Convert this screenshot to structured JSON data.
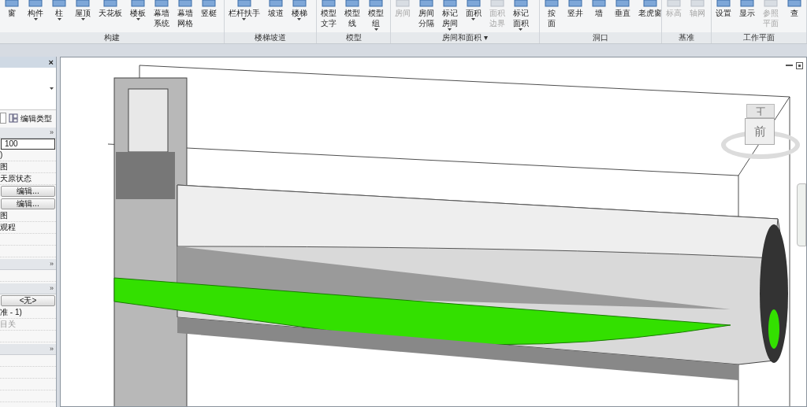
{
  "ribbon": {
    "groups": [
      {
        "label": "构建",
        "buttons": [
          {
            "lines": [
              "窗"
            ],
            "dropdown": false,
            "disabled": false
          },
          {
            "lines": [
              "构件"
            ],
            "dropdown": true,
            "disabled": false
          },
          {
            "lines": [
              "柱"
            ],
            "dropdown": true,
            "disabled": false
          },
          {
            "lines": [
              "屋顶"
            ],
            "dropdown": true,
            "disabled": false
          },
          {
            "lines": [
              "天花板"
            ],
            "dropdown": false,
            "disabled": false
          },
          {
            "lines": [
              "楼板"
            ],
            "dropdown": true,
            "disabled": false
          },
          {
            "lines": [
              "幕墙",
              "系统"
            ],
            "dropdown": false,
            "disabled": false
          },
          {
            "lines": [
              "幕墙",
              "网格"
            ],
            "dropdown": false,
            "disabled": false
          },
          {
            "lines": [
              "竖梃"
            ],
            "dropdown": false,
            "disabled": false
          }
        ]
      },
      {
        "label": "楼梯坡道",
        "buttons": [
          {
            "lines": [
              "栏杆扶手"
            ],
            "dropdown": true,
            "disabled": false
          },
          {
            "lines": [
              "坡道"
            ],
            "dropdown": false,
            "disabled": false
          },
          {
            "lines": [
              "楼梯"
            ],
            "dropdown": true,
            "disabled": false
          }
        ]
      },
      {
        "label": "模型",
        "buttons": [
          {
            "lines": [
              "模型",
              "文字"
            ],
            "dropdown": false,
            "disabled": false
          },
          {
            "lines": [
              "模型",
              "线"
            ],
            "dropdown": false,
            "disabled": false
          },
          {
            "lines": [
              "模型",
              "组"
            ],
            "dropdown": true,
            "disabled": false
          }
        ]
      },
      {
        "label": "房间和面积 ▾",
        "buttons": [
          {
            "lines": [
              "房间"
            ],
            "dropdown": false,
            "disabled": true
          },
          {
            "lines": [
              "房间",
              "分隔"
            ],
            "dropdown": false,
            "disabled": false
          },
          {
            "lines": [
              "标记",
              "房间"
            ],
            "dropdown": true,
            "disabled": false
          },
          {
            "lines": [
              "面积"
            ],
            "dropdown": true,
            "disabled": false
          },
          {
            "lines": [
              "面积",
              "边界"
            ],
            "dropdown": false,
            "disabled": true
          },
          {
            "lines": [
              "标记",
              "面积"
            ],
            "dropdown": true,
            "disabled": false
          }
        ]
      },
      {
        "label": "洞口",
        "buttons": [
          {
            "lines": [
              "按",
              "面"
            ],
            "dropdown": false,
            "disabled": false
          },
          {
            "lines": [
              "竖井"
            ],
            "dropdown": false,
            "disabled": false
          },
          {
            "lines": [
              "墙"
            ],
            "dropdown": false,
            "disabled": false
          },
          {
            "lines": [
              "垂直"
            ],
            "dropdown": false,
            "disabled": false
          },
          {
            "lines": [
              "老虎窗"
            ],
            "dropdown": false,
            "disabled": false
          }
        ]
      },
      {
        "label": "基准",
        "buttons": [
          {
            "lines": [
              "标高"
            ],
            "dropdown": false,
            "disabled": true
          },
          {
            "lines": [
              "轴网"
            ],
            "dropdown": false,
            "disabled": true
          }
        ]
      },
      {
        "label": "工作平面",
        "buttons": [
          {
            "lines": [
              "设置"
            ],
            "dropdown": false,
            "disabled": false
          },
          {
            "lines": [
              "显示"
            ],
            "dropdown": false,
            "disabled": false
          },
          {
            "lines": [
              "参照",
              "平面"
            ],
            "dropdown": false,
            "disabled": true
          },
          {
            "lines": [
              "查"
            ],
            "dropdown": false,
            "disabled": false
          }
        ]
      }
    ]
  },
  "properties": {
    "close": "×",
    "edit_type": "编辑类型",
    "rows": [
      {
        "kind": "header",
        "text": "»"
      },
      {
        "kind": "field",
        "text": "100"
      },
      {
        "kind": "text",
        "text": ")",
        "disabled": false
      },
      {
        "kind": "text",
        "text": "图",
        "disabled": false
      },
      {
        "kind": "text",
        "text": "天原状态",
        "disabled": false
      },
      {
        "kind": "button",
        "text": "编辑..."
      },
      {
        "kind": "button",
        "text": "编辑..."
      },
      {
        "kind": "text",
        "text": "图",
        "disabled": false
      },
      {
        "kind": "text",
        "text": "观程",
        "disabled": false
      },
      {
        "kind": "empty"
      },
      {
        "kind": "empty"
      },
      {
        "kind": "header",
        "text": "»"
      },
      {
        "kind": "empty"
      },
      {
        "kind": "header",
        "text": "»"
      },
      {
        "kind": "button",
        "text": "<无>"
      },
      {
        "kind": "text",
        "text": "准 - 1)",
        "disabled": false
      },
      {
        "kind": "text",
        "text": "目关",
        "disabled": true
      },
      {
        "kind": "empty"
      },
      {
        "kind": "header",
        "text": "»"
      },
      {
        "kind": "empty"
      },
      {
        "kind": "empty"
      },
      {
        "kind": "empty"
      },
      {
        "kind": "empty"
      }
    ]
  },
  "viewcube": {
    "front": "前",
    "top": "上"
  }
}
